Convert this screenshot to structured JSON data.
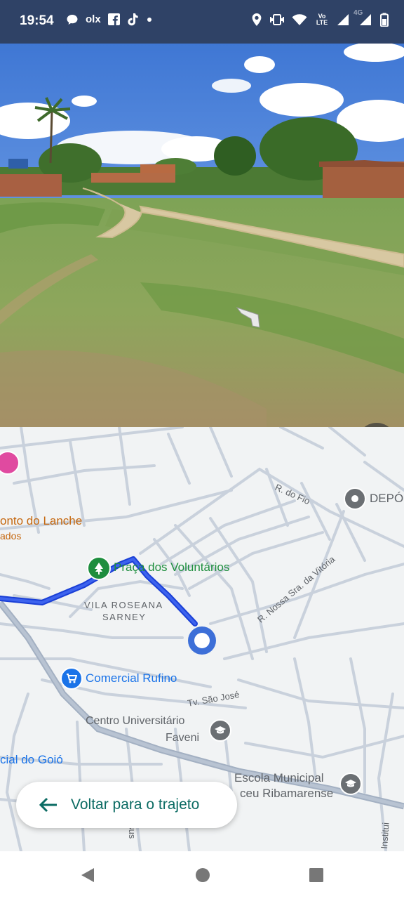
{
  "status_bar": {
    "time": "19:54",
    "left_icons": [
      "chat-bubble-icon",
      "olx-icon",
      "facebook-icon",
      "tiktok-icon",
      "dot-icon"
    ],
    "olx_text": "olx",
    "right_icons": [
      "location-icon",
      "vibrate-icon",
      "wifi-icon",
      "volte-icon",
      "signal-icon",
      "signal-4g-icon",
      "battery-icon"
    ],
    "volte_text": "Vo LTE",
    "network_text": "4G"
  },
  "street_view": {
    "expand_button": "expand-icon"
  },
  "map": {
    "labels": {
      "poi_lanche": "onto do Lanche",
      "poi_lanche_sub": "ados",
      "praca": "Praça dos Voluntários",
      "vila_line1": "VILA ROSEANA",
      "vila_line2": "SARNEY",
      "street_fio": "R. do Fio",
      "deposito": "DEPÓ",
      "street_nossa": "R. Nossa Sra. da Vitória",
      "comercial": "Comercial Rufino",
      "street_sao_jose": "Tv. São José",
      "centro_line1": "Centro Universitário",
      "centro_line2": "Faveni",
      "goio": "cial do Goió",
      "escola_line1": "Escola Municipal",
      "escola_line2": "ceu Ribamarense",
      "street_bottom1": "Institui",
      "street_bottom2": "sus"
    },
    "colors": {
      "route": "#1a3fd6",
      "poi_green": "#1e8e3e",
      "poi_blue": "#1a73e8",
      "poi_gray": "#6b6f73",
      "poi_orange": "#c5670e",
      "poi_pink": "#e04aa0"
    }
  },
  "back_button": {
    "label": "Voltar para o trajeto"
  },
  "nav_bar": {
    "buttons": [
      "back-triangle",
      "home-circle",
      "recents-square"
    ]
  }
}
